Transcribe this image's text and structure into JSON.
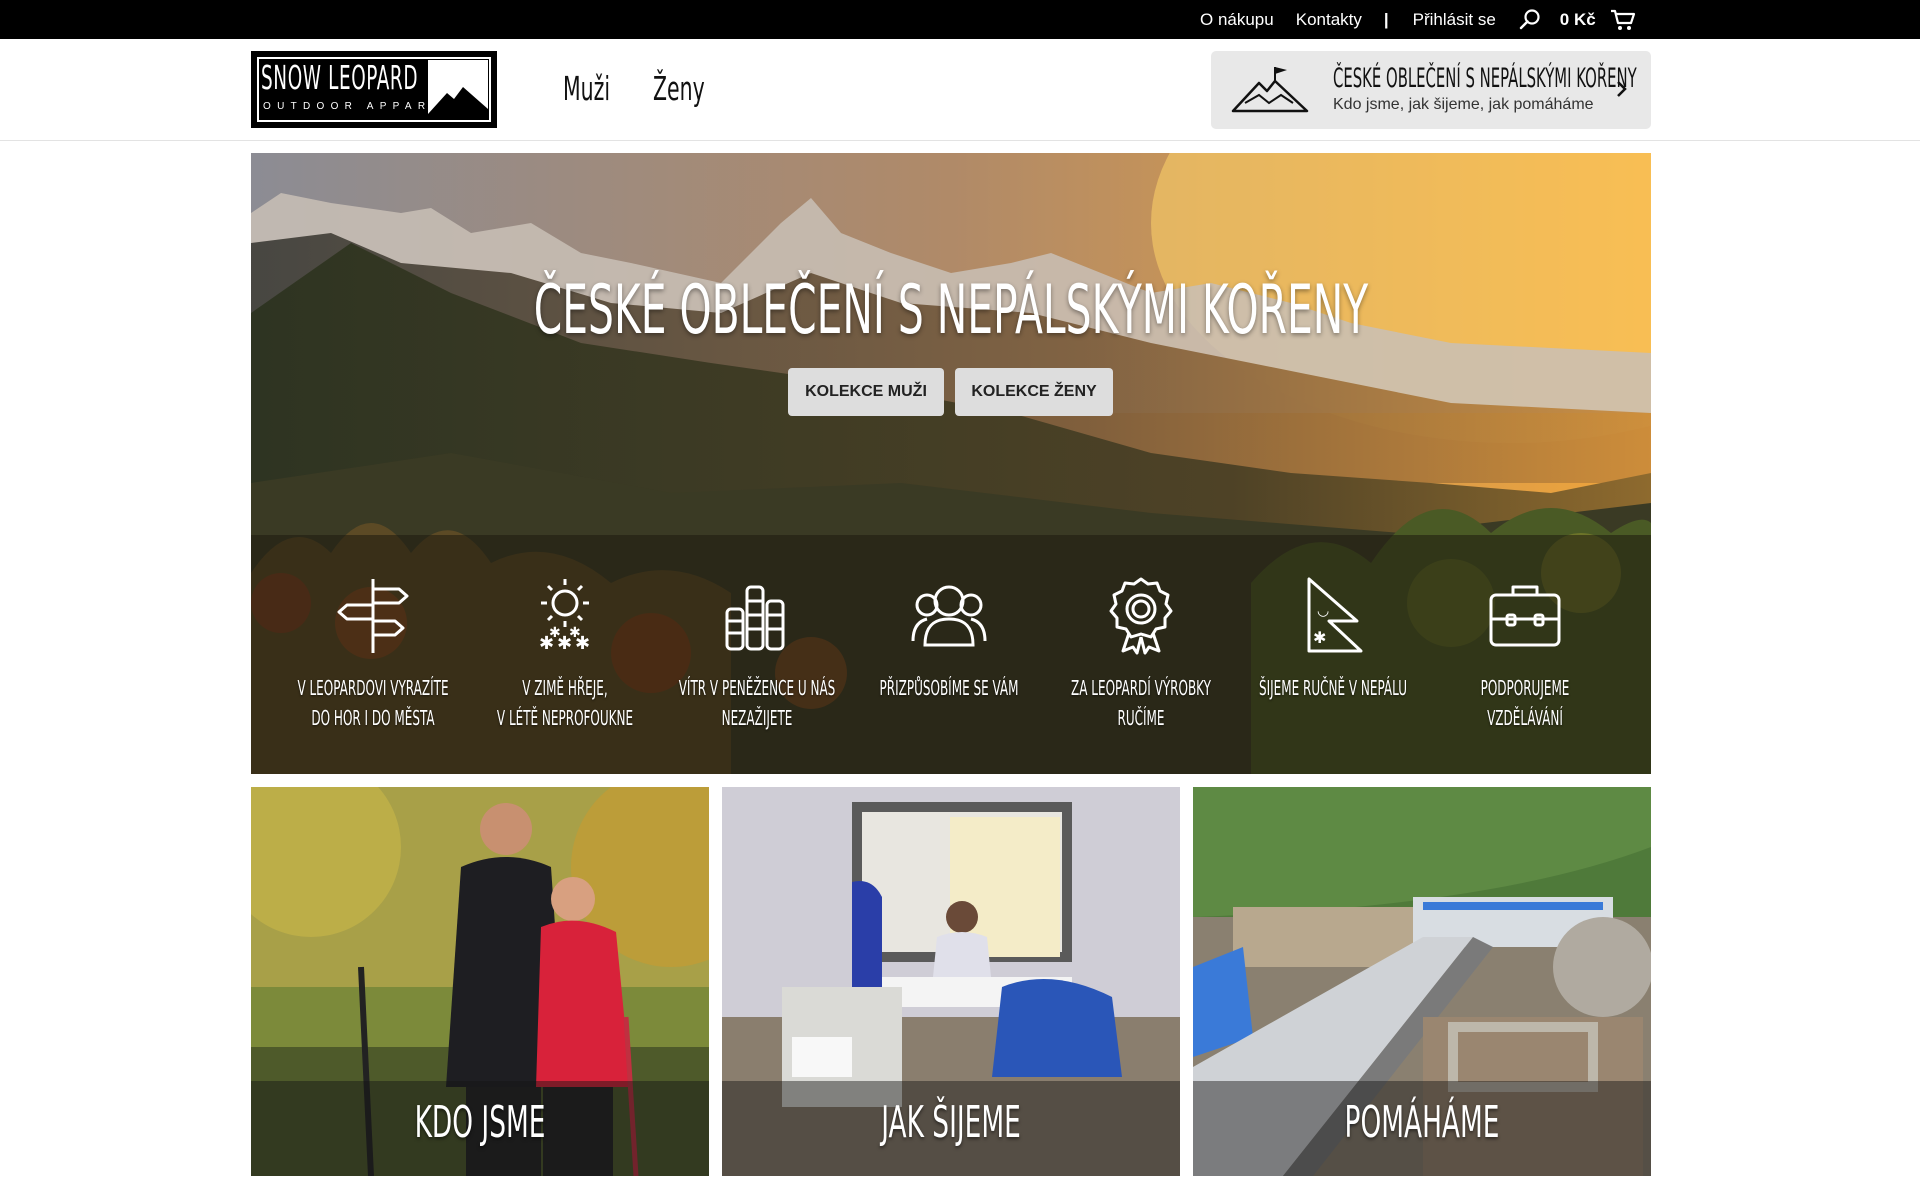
{
  "topbar": {
    "links": [
      "O nákupu",
      "Kontakty"
    ],
    "separator": "|",
    "login": "Přihlásit se",
    "cart_total": "0 Kč",
    "icons": [
      "search-icon",
      "cart-icon"
    ]
  },
  "header": {
    "logo": {
      "title": "SNOW LEOPARD",
      "subtitle": "OUTDOOR APPAREL"
    },
    "nav": [
      "Muži",
      "Ženy"
    ],
    "promo": {
      "title": "ČESKÉ OBLEČENÍ S NEPÁLSKÝMI KOŘENY",
      "subtitle": "Kdo jsme, jak šijeme, jak pomáháme"
    }
  },
  "hero": {
    "title": "ČESKÉ OBLEČENÍ S NEPÁLSKÝMI KOŘENY",
    "buttons": [
      "KOLEKCE MUŽI",
      "KOLEKCE ŽENY"
    ],
    "features": [
      {
        "icon": "signpost-icon",
        "line1": "V LEOPARDOVI VYRAZÍTE",
        "line2": "DO HOR I DO MĚSTA"
      },
      {
        "icon": "sun-snow-icon",
        "line1": "V ZIMĚ HŘEJE,",
        "line2": "V LÉTĚ NEPROFOUKNE"
      },
      {
        "icon": "coins-icon",
        "line1": "VÍTR V PENĚŽENCE U NÁS",
        "line2": "NEZAŽIJETE"
      },
      {
        "icon": "people-icon",
        "line1": "PŘIZPŮSOBÍME SE VÁM",
        "line2": ""
      },
      {
        "icon": "rosette-icon",
        "line1": "ZA LEOPARDÍ VÝROBKY",
        "line2": "RUČÍME"
      },
      {
        "icon": "nepal-flag-icon",
        "line1": "ŠIJEME RUČNĚ V NEPÁLU",
        "line2": ""
      },
      {
        "icon": "briefcase-icon",
        "line1": "PODPORUJEME",
        "line2": "VZDĚLÁVÁNÍ"
      }
    ]
  },
  "tiles": [
    "KDO JSME",
    "JAK ŠIJEME",
    "POMÁHÁME"
  ],
  "colors": {
    "topbar": "#000000",
    "button_bg": "#dddddd",
    "promo_bg": "#e8e8e8"
  }
}
